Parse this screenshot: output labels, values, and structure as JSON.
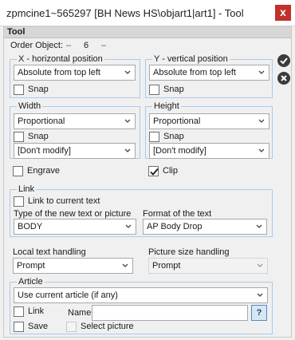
{
  "window": {
    "title": "zpmcine1~565297 [BH News HS\\objart1|art1] - Tool",
    "close_label": "x"
  },
  "panel": {
    "header": "Tool"
  },
  "order": {
    "label": "Order Object:",
    "prev": "–",
    "value": "6",
    "next": "–"
  },
  "x_pos": {
    "title": "X - horizontal position",
    "select": "Absolute from top left",
    "snap": "Snap"
  },
  "y_pos": {
    "title": "Y - vertical position",
    "select": "Absolute from top left",
    "snap": "Snap"
  },
  "width": {
    "title": "Width",
    "select": "Proportional",
    "snap": "Snap",
    "modify": "[Don't modify]"
  },
  "height": {
    "title": "Height",
    "select": "Proportional",
    "snap": "Snap",
    "modify": "[Don't modify]"
  },
  "engrave": {
    "label": "Engrave",
    "checked": false
  },
  "clip": {
    "label": "Clip",
    "checked": true
  },
  "link": {
    "title": "Link",
    "link_current": "Link to current text",
    "type_label": "Type of the new text or picture",
    "type_value": "BODY",
    "format_label": "Format of the text",
    "format_value": "AP Body Drop"
  },
  "local_text": {
    "label": "Local text handling",
    "value": "Prompt"
  },
  "picture_size": {
    "label": "Picture size handling",
    "value": "Prompt"
  },
  "article": {
    "title": "Article",
    "select": "Use current article (if any)",
    "link": "Link",
    "name_label": "Name",
    "name_value": "",
    "help": "?",
    "save": "Save",
    "select_picture": "Select picture"
  },
  "colors": {
    "group_border": "#a9cbe9",
    "close_bg": "#c1302b",
    "check": "#1a1a1a"
  },
  "icons": {
    "ok": "check-circle-icon",
    "cancel": "x-circle-icon",
    "dropdown": "chevron-down-icon"
  }
}
